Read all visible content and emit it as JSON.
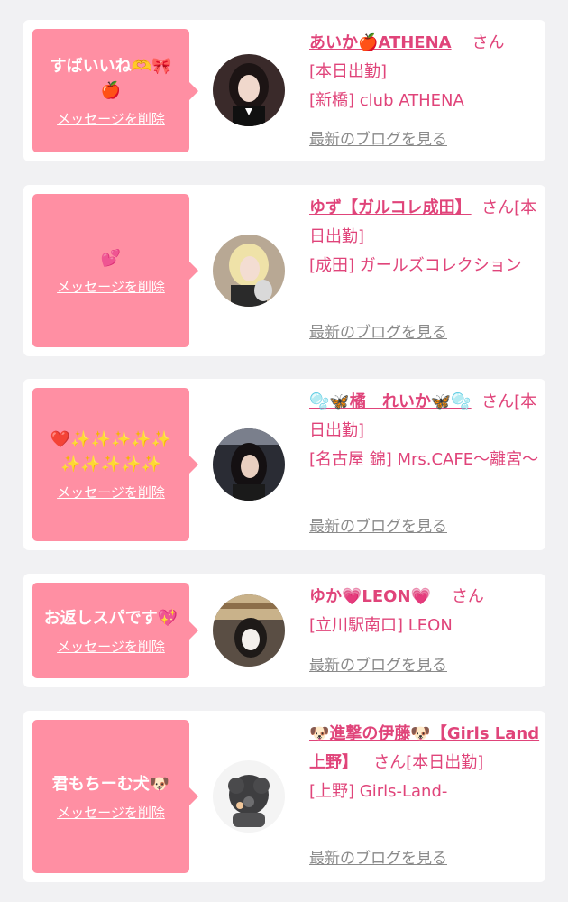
{
  "items": [
    {
      "message": "すばいいね🫶🎀🍎",
      "delete_label": "メッセージを削除",
      "name": "あいか🍎ATHENA",
      "honorific": "さん",
      "status": "[本日出勤]",
      "shop": "[新橋] club ATHENA",
      "blog_label": "最新のブログを見る"
    },
    {
      "message": "💕",
      "delete_label": "メッセージを削除",
      "name": "ゆず【ガルコレ成田】",
      "honorific": "さん",
      "status": "[本日出勤]",
      "shop": "[成田] ガールズコレクション",
      "blog_label": "最新のブログを見る"
    },
    {
      "message": "❤️✨✨✨✨✨✨✨✨✨✨",
      "delete_label": "メッセージを削除",
      "name": "🫧🦋橘　れいか🦋🫧",
      "honorific": "さん",
      "status": "[本日出勤]",
      "shop": "[名古屋 錦] Mrs.CAFE～離宮～",
      "blog_label": "最新のブログを見る"
    },
    {
      "message": "お返しスパです💖",
      "delete_label": "メッセージを削除",
      "name": "ゆか💗LEON💗",
      "honorific": "さん",
      "status": "",
      "shop": "[立川駅南口] LEON",
      "blog_label": "最新のブログを見る"
    },
    {
      "message": "君もちーむ犬🐶",
      "delete_label": "メッセージを削除",
      "name": "🐶進撃の伊藤🐶【Girls Land上野】",
      "honorific": "さん",
      "status": "[本日出勤]",
      "shop": "[上野] Girls-Land-",
      "blog_label": "最新のブログを見る"
    }
  ]
}
